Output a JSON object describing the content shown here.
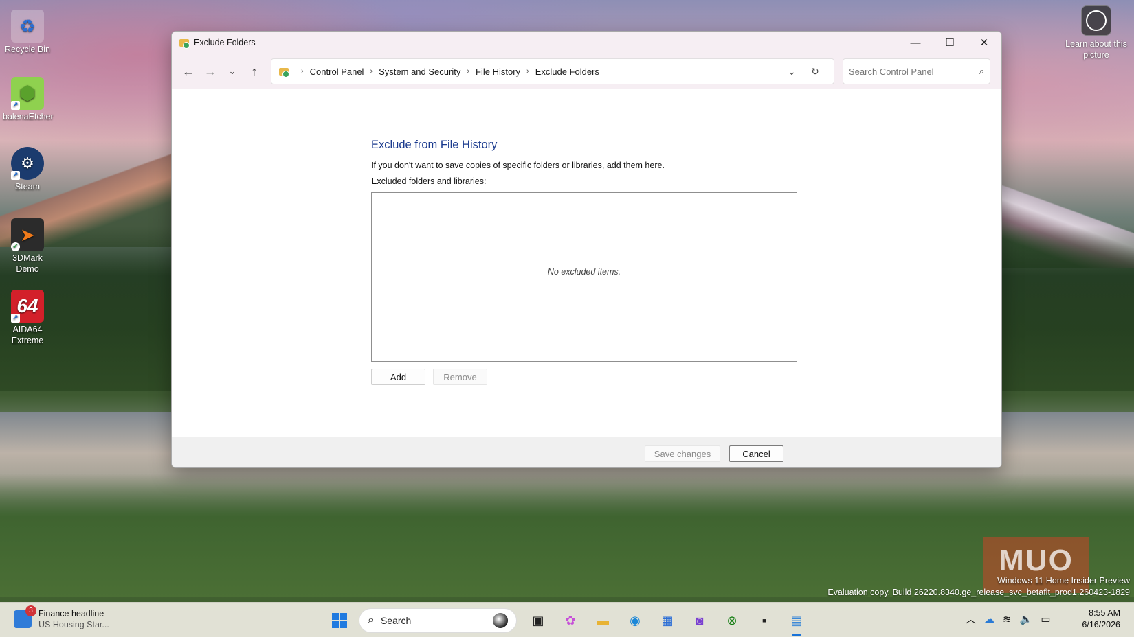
{
  "desktop": {
    "icons": [
      {
        "label": "Recycle Bin"
      },
      {
        "label": "balenaEtcher"
      },
      {
        "label": "Steam"
      },
      {
        "label": "3DMark Demo"
      },
      {
        "label": "AIDA64 Extreme"
      }
    ],
    "learn_label": "Learn about this picture",
    "watermark_line1": "Windows 11 Home Insider Preview",
    "watermark_line2": "Evaluation copy. Build 26220.8340.ge_release_svc_betaflt_prod1.260423-1829",
    "muo": "MUO"
  },
  "window": {
    "title": "Exclude Folders",
    "controls": {
      "minimize": "—",
      "maximize": "☐",
      "close": "✕"
    },
    "breadcrumb": [
      "Control Panel",
      "System and Security",
      "File History",
      "Exclude Folders"
    ],
    "search_placeholder": "Search Control Panel",
    "heading": "Exclude from File History",
    "description": "If you don't want to save copies of specific folders or libraries, add them here.",
    "list_label": "Excluded folders and libraries:",
    "empty_text": "No excluded items.",
    "add_label": "Add",
    "remove_label": "Remove",
    "save_label": "Save changes",
    "cancel_label": "Cancel"
  },
  "taskbar": {
    "widget_badge": "3",
    "widget_title": "Finance headline",
    "widget_subtitle": "US Housing Star...",
    "search_label": "Search",
    "time": "8:55 AM",
    "date": "6/16/2026"
  },
  "colors": {
    "accent": "#1a3a8e",
    "taskbar_indicator": "#1a73d9"
  }
}
